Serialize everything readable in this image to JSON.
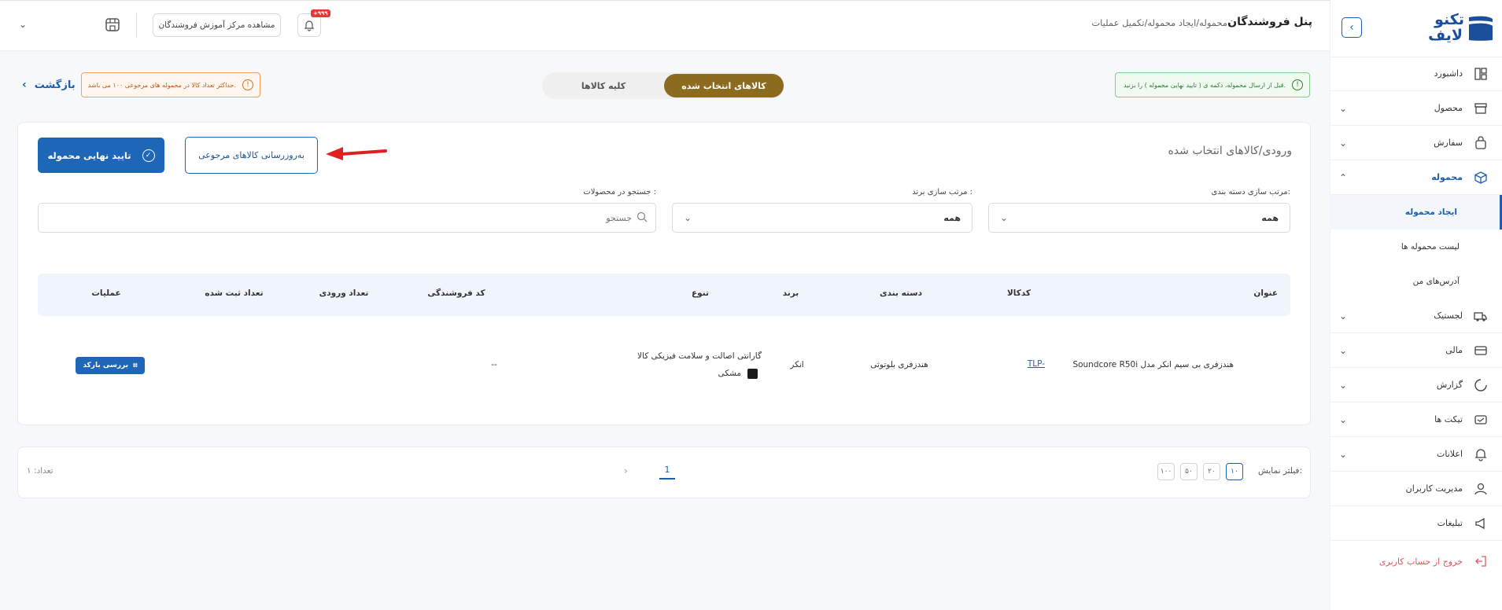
{
  "header": {
    "panel_title": "پنل فروشندگان",
    "breadcrumb": "محموله/ایجاد محموله/تکمیل عملیات",
    "training_button": "مشاهده مرکز آموزش فروشندگان",
    "notification_badge": "+۹۹۹"
  },
  "sidebar": {
    "logo_line1": "تکنو",
    "logo_line2": "لایف",
    "items": [
      {
        "label": "داشبورد",
        "icon": "dashboard-icon"
      },
      {
        "label": "محصول",
        "icon": "box-icon"
      },
      {
        "label": "سفارش",
        "icon": "bag-icon"
      },
      {
        "label": "محموله",
        "icon": "package-icon"
      },
      {
        "label": "لجستیک",
        "icon": "truck-icon"
      },
      {
        "label": "مالی",
        "icon": "card-icon"
      },
      {
        "label": "گزارش",
        "icon": "chart-icon"
      },
      {
        "label": "تیکت ها",
        "icon": "ticket-icon"
      },
      {
        "label": "اعلانات",
        "icon": "bell-icon"
      },
      {
        "label": "مدیریت کاربران",
        "icon": "user-icon"
      },
      {
        "label": "تبلیغات",
        "icon": "megaphone-icon"
      },
      {
        "label": "خروج از حساب کاربری",
        "icon": "logout-icon"
      }
    ],
    "sub_items": [
      "ایجاد محموله",
      "لیست محموله ها",
      "آدرس‌های من"
    ]
  },
  "notices": {
    "info": "قبل از ارسال محموله، دکمه ی ( تایید نهایی محموله ) را بزنید.",
    "warning": "حداکثر تعداد کالا در محموله های مرجوعی ۱۰۰ می باشد."
  },
  "tabs": {
    "selected": "کالاهای انتخاب شده",
    "all": "کلیه کالاها"
  },
  "back_label": "بازگشت",
  "section": {
    "title": "ورودی/کالاهای انتخاب شده",
    "update_returns_button": "به‌روزرسانی کالاهای مرجوعی",
    "confirm_button": "تایید نهایی محموله"
  },
  "filters": {
    "category_label": "مرتب سازی دسته بندی:",
    "category_value": "همه",
    "brand_label": "مرتب سازی برند :",
    "brand_value": "همه",
    "search_label": "جستجو در محصولات :",
    "search_placeholder": "جستجو"
  },
  "table": {
    "headers": {
      "title": "عنوان",
      "code": "کدکالا",
      "category": "دسته بندی",
      "brand": "برند",
      "variant": "تنوع",
      "seller_code": "کد فروشندگی",
      "entry_count": "تعداد ورودی",
      "registered_count": "تعداد ثبت شده",
      "actions": "عملیات"
    },
    "rows": [
      {
        "title": "هندزفری بی سیم انکر مدل Soundcore R50i",
        "code": "TLP-",
        "category": "هندزفری بلوتوثی",
        "brand": "انکر",
        "variant_warranty": "گارانتی اصالت و سلامت فیزیکی کالا",
        "variant_color": "مشکی",
        "variant_color_hex": "#1a1a1a",
        "seller_code": "--",
        "action": "بررسی بارکد"
      }
    ]
  },
  "pagination": {
    "filter_label": "فیلتر نمایش:",
    "sizes": [
      "۱۰",
      "۲۰",
      "۵۰",
      "۱۰۰"
    ],
    "current_page": "1",
    "count_label": "تعداد: ۱"
  },
  "colors": {
    "primary": "#1e66b8",
    "gold": "#8c6a1e",
    "arrow": "#e02020"
  }
}
